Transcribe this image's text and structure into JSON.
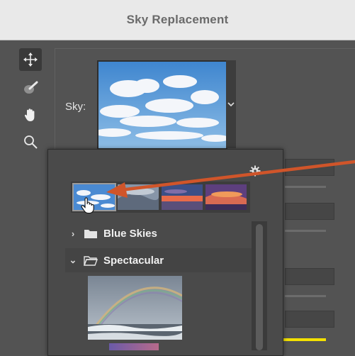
{
  "window": {
    "title": "Sky Replacement"
  },
  "tools": [
    {
      "name": "move-tool",
      "icon": "move-icon"
    },
    {
      "name": "sky-brush-tool",
      "icon": "brush-icon"
    },
    {
      "name": "hand-tool",
      "icon": "hand-icon"
    },
    {
      "name": "zoom-tool",
      "icon": "magnifier-icon"
    }
  ],
  "sky": {
    "label": "Sky:"
  },
  "presets": {
    "groups": [
      {
        "label": "Blue Skies",
        "expanded": false
      },
      {
        "label": "Spectacular",
        "expanded": true
      }
    ]
  },
  "colors": {
    "accent_arrow": "#d0552a",
    "highlight": "#f3e100"
  }
}
